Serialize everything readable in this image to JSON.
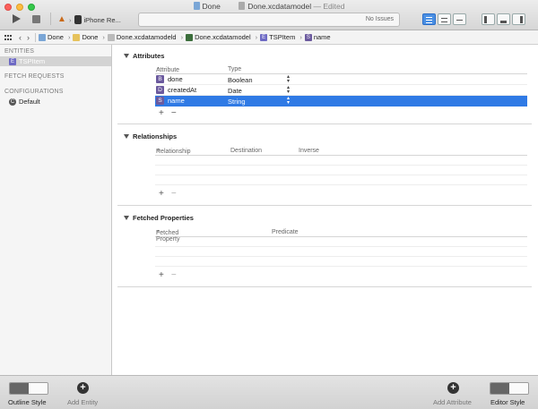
{
  "window": {
    "title_project": "Done",
    "title_file": "Done.xcdatamodel",
    "title_status": "— Edited"
  },
  "toolbar": {
    "scheme_device": "iPhone Re...",
    "status_text": "No Issues"
  },
  "jumpbar": {
    "crumbs": [
      "Done",
      "Done",
      "Done.xcdatamodeld",
      "Done.xcdatamodel",
      "TSPItem",
      "name"
    ]
  },
  "sidebar": {
    "entities_header": "ENTITIES",
    "entities": [
      {
        "label": "TSPItem",
        "badge": "E"
      }
    ],
    "fetch_header": "FETCH REQUESTS",
    "config_header": "CONFIGURATIONS",
    "configurations": [
      {
        "label": "Default",
        "badge": "C"
      }
    ]
  },
  "attributes": {
    "title": "Attributes",
    "col_attribute": "Attribute",
    "col_type": "Type",
    "rows": [
      {
        "name": "done",
        "badge": "B",
        "badge_color": "#6b5a9e",
        "type": "Boolean"
      },
      {
        "name": "createdAt",
        "badge": "D",
        "badge_color": "#6b5a9e",
        "type": "Date"
      },
      {
        "name": "name",
        "badge": "S",
        "badge_color": "#6b5a9e",
        "type": "String"
      }
    ],
    "add": "+",
    "remove": "−"
  },
  "relationships": {
    "title": "Relationships",
    "col_relationship": "Relationship",
    "col_destination": "Destination",
    "col_inverse": "Inverse",
    "add": "+",
    "remove": "−"
  },
  "fetched": {
    "title": "Fetched Properties",
    "col_property": "Fetched Property",
    "col_predicate": "Predicate",
    "add": "+",
    "remove": "−"
  },
  "bottombar": {
    "outline_style": "Outline Style",
    "add_entity": "Add Entity",
    "add_attribute": "Add Attribute",
    "editor_style": "Editor Style"
  },
  "colors": {
    "selection": "#2f7ae5",
    "entity_badge": "#6e6ac4"
  }
}
